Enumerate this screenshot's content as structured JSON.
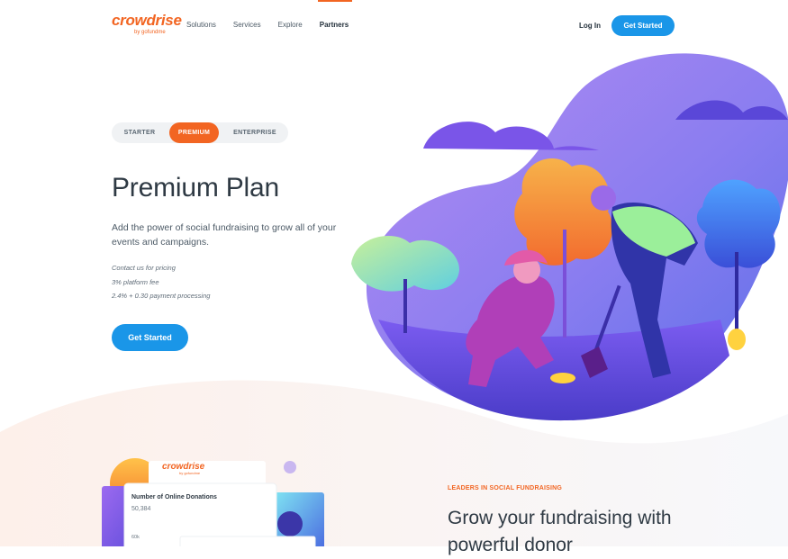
{
  "header": {
    "logo": {
      "word": "crowdrise",
      "sub": "by gofundme"
    },
    "nav": [
      "Solutions",
      "Services",
      "Explore",
      "Partners"
    ],
    "login": "Log In",
    "cta": "Get Started"
  },
  "plans": {
    "tabs": [
      "STARTER",
      "PREMIUM",
      "ENTERPRISE"
    ],
    "selected": "PREMIUM"
  },
  "hero": {
    "title": "Premium Plan",
    "description": "Add the power of social fundraising to grow all of your events and campaigns.",
    "pricing": [
      "Contact us for pricing",
      "3% platform fee",
      "2.4% + 0.30 payment processing"
    ],
    "cta": "Get Started"
  },
  "feature": {
    "eyebrow": "LEADERS IN SOCIAL FUNDRAISING",
    "headline": "Grow your fundraising with powerful donor"
  },
  "card": {
    "logo_word": "crowdrise",
    "logo_sub": "by gofundme",
    "title": "Number of Online Donations",
    "value": "50,384",
    "axis_tick": "60k"
  },
  "colors": {
    "brand_orange": "#f26522",
    "primary_blue": "#1a96e8",
    "illustration_purple": "#6a4fd6"
  }
}
